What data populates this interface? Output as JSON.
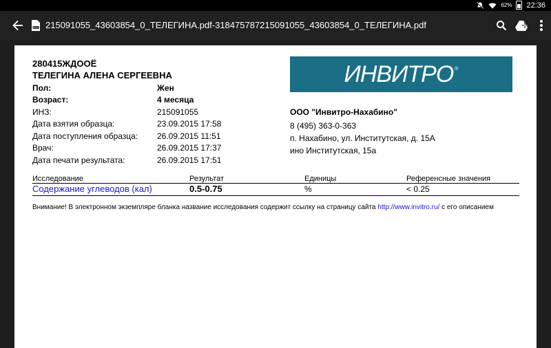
{
  "status_bar": {
    "battery": "62%",
    "time": "22:36",
    "icons": [
      "notifications-off-icon",
      "wifi-icon",
      "battery-icon"
    ]
  },
  "app_bar": {
    "title": "215091055_43603854_0_ТЕЛЕГИНА.pdf-318475787215091055_43603854_0_ТЕЛЕГИНА.pdf",
    "icons": [
      "back-arrow-icon",
      "pdf-file-icon",
      "search-icon",
      "google-drive-icon",
      "more-vert-icon"
    ]
  },
  "document": {
    "code": "280415ЖДООЁ",
    "patient_name": "ТЕЛЕГИНА АЛЕНА СЕРГЕЕВНА",
    "fields": [
      {
        "label": "Пол:",
        "value": "Жен"
      },
      {
        "label": "Возраст:",
        "value": "4 месяца"
      },
      {
        "label": "ИНЗ:",
        "value": "215091055"
      },
      {
        "label": "Дата взятия образца:",
        "value": "23.09.2015 17:58"
      },
      {
        "label": "Дата поступления образца:",
        "value": "26.09.2015 11:51"
      },
      {
        "label": "Врач:",
        "value": "26.09.2015 17:37"
      },
      {
        "label": "Дата печати результата:",
        "value": "26.09.2015 17:51"
      }
    ],
    "logo_text": "ИНВИТРО",
    "logo_mark": "®",
    "lab_name": "ООО \"Инвитро-Нахабино\"",
    "lab_phone": "8 (495) 363-0-363",
    "lab_address": "п. Нахабино, ул. Институтская, д. 15А",
    "lab_address2": "ино Институтская, 15а",
    "table": {
      "headers": [
        "Исследование",
        "Результат",
        "Единицы",
        "Референсные значения"
      ],
      "rows": [
        {
          "test": "Содержание углеводов (кал)",
          "result": "0.5-0.75",
          "units": "%",
          "reference": "< 0.25"
        }
      ]
    },
    "notice": {
      "text_before": "Внимание! В электронном экземпляре бланка название исследования содержит ссылку на страницу сайта",
      "link": "http://www.invitro.ru/",
      "text_after": "с его описанием"
    },
    "colors": {
      "logo_bg": "#1a6f86",
      "link": "#1a1acc"
    }
  }
}
